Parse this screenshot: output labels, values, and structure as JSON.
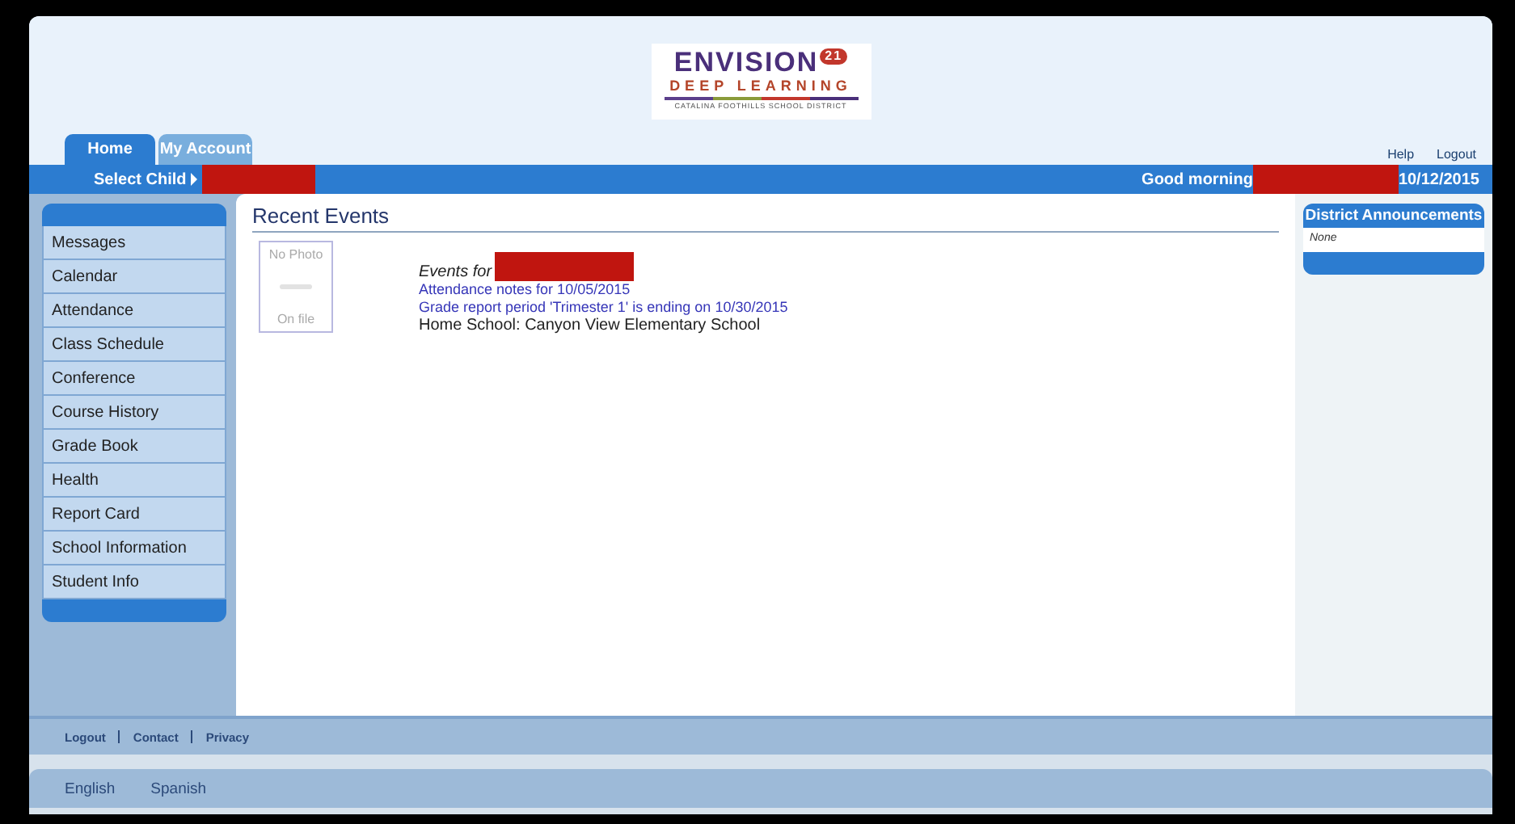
{
  "logo": {
    "title": "ENVISION",
    "badge": "21",
    "subtitle": "DEEP LEARNING",
    "district": "CATALINA FOOTHILLS SCHOOL DISTRICT"
  },
  "tabs": [
    {
      "label": "Home",
      "selected": true
    },
    {
      "label": "My Account",
      "selected": false
    }
  ],
  "top_links": [
    "Help",
    "Logout"
  ],
  "child_bar": {
    "select_label": "Select Child",
    "greeting": "Good morning",
    "date": "10/12/2015"
  },
  "sidebar": {
    "items": [
      "Messages",
      "Calendar",
      "Attendance",
      "Class Schedule",
      "Conference",
      "Course History",
      "Grade Book",
      "Health",
      "Report Card",
      "School Information",
      "Student Info"
    ]
  },
  "recent_events": {
    "title": "Recent Events",
    "photo": {
      "top": "No Photo",
      "bottom": "On file"
    },
    "events_for": "Events for",
    "lines": [
      {
        "text": "Attendance notes for 10/05/2015",
        "kind": "link"
      },
      {
        "text": "Grade report period 'Trimester 1' is ending on 10/30/2015",
        "kind": "link"
      },
      {
        "text": "Home School: Canyon View Elementary School",
        "kind": "plain"
      }
    ]
  },
  "announcements": {
    "title": "District Announcements",
    "body": "None"
  },
  "footer_links": [
    "Logout",
    "Contact",
    "Privacy"
  ],
  "languages": [
    "English",
    "Spanish"
  ]
}
